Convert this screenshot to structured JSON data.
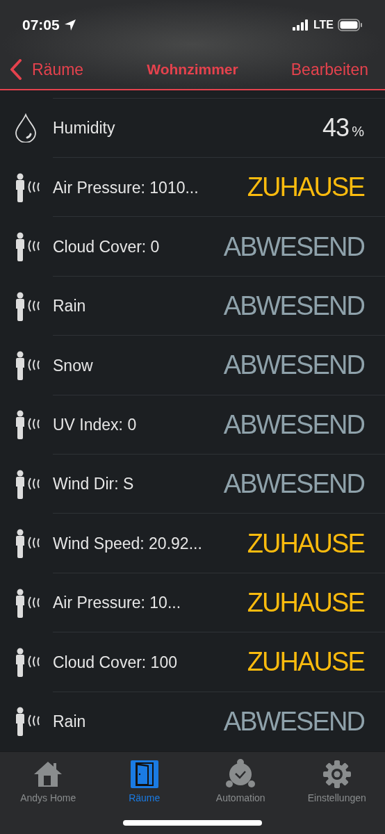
{
  "status_bar": {
    "time": "07:05",
    "network": "LTE"
  },
  "nav": {
    "back": "Räume",
    "title": "Wohnzimmer",
    "action": "Bearbeiten"
  },
  "rows": [
    {
      "kind": "sensor",
      "label": "Humidity",
      "value": "43",
      "unit": "%"
    },
    {
      "kind": "presence",
      "label": "Air Pressure: 1010...",
      "state": "ZUHAUSE",
      "home": true
    },
    {
      "kind": "presence",
      "label": "Cloud Cover: 0",
      "state": "ABWESEND",
      "home": false
    },
    {
      "kind": "presence",
      "label": "Rain",
      "state": "ABWESEND",
      "home": false
    },
    {
      "kind": "presence",
      "label": "Snow",
      "state": "ABWESEND",
      "home": false
    },
    {
      "kind": "presence",
      "label": "UV Index: 0",
      "state": "ABWESEND",
      "home": false
    },
    {
      "kind": "presence",
      "label": "Wind Dir: S",
      "state": "ABWESEND",
      "home": false
    },
    {
      "kind": "presence",
      "label": "Wind Speed: 20.92...",
      "state": "ZUHAUSE",
      "home": true
    },
    {
      "kind": "presence",
      "label": "Air Pressure: 10...",
      "state": "ZUHAUSE",
      "home": true
    },
    {
      "kind": "presence",
      "label": "Cloud Cover: 100",
      "state": "ZUHAUSE",
      "home": true
    },
    {
      "kind": "presence",
      "label": "Rain",
      "state": "ABWESEND",
      "home": false
    }
  ],
  "tabs": [
    {
      "kind": "home",
      "label": "Andys Home",
      "selected": false
    },
    {
      "kind": "door",
      "label": "Räume",
      "selected": true
    },
    {
      "kind": "alarm",
      "label": "Automation",
      "selected": false
    },
    {
      "kind": "gear",
      "label": "Einstellungen",
      "selected": false
    }
  ]
}
